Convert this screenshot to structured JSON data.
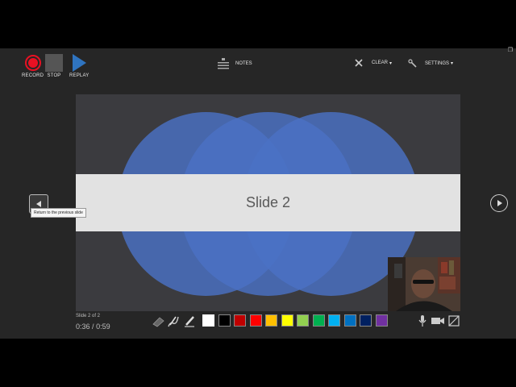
{
  "toolbar": {
    "record_label": "RECORD",
    "stop_label": "STOP",
    "replay_label": "REPLAY",
    "notes_label": "NOTES",
    "clear_label": "CLEAR",
    "settings_label": "SETTINGS"
  },
  "slide": {
    "title": "Slide 2"
  },
  "navigation": {
    "tooltip": "Return to the previous slide"
  },
  "status": {
    "slide_count": "Slide 2 of 2",
    "time_elapsed": "0:36",
    "time_separator": "/",
    "time_total": "0:59"
  },
  "ink_colors": [
    "#ffffff",
    "#000000",
    "#c00000",
    "#ff0000",
    "#ffc000",
    "#ffff00",
    "#92d050",
    "#00b050",
    "#00b0f0",
    "#0070c0",
    "#002060",
    "#7030a0"
  ],
  "colors": {
    "record": "#e81123",
    "replay": "#2f74c0",
    "slide_circles": "#4a72c4",
    "title_band": "#e2e2e2"
  }
}
